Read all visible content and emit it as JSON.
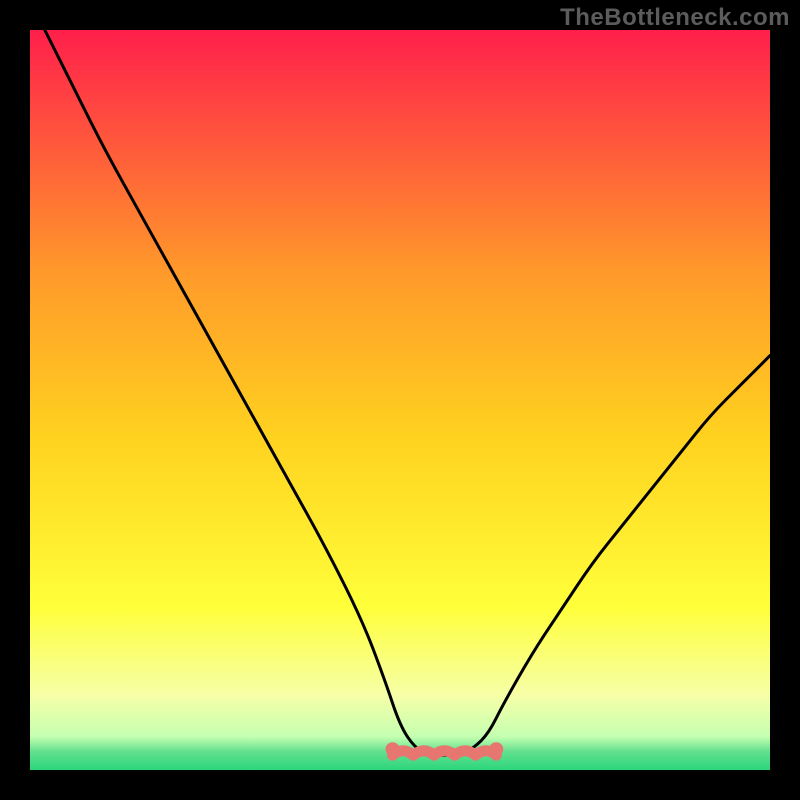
{
  "watermark": "TheBottleneck.com",
  "colors": {
    "frame_bg": "#000000",
    "watermark": "#5c5c5c",
    "curve": "#000000",
    "bottom_bar": "#e77670",
    "grad_top": "#ff1f4b",
    "grad_mid1": "#ff7a2a",
    "grad_mid2": "#ffd21f",
    "grad_mid3": "#ffff3a",
    "grad_low1": "#f6ffa8",
    "grad_low2": "#c4ffb0",
    "grad_bottom": "#2bd67b"
  },
  "chart_data": {
    "type": "line",
    "title": "",
    "xlabel": "",
    "ylabel": "",
    "xlim": [
      0,
      100
    ],
    "ylim": [
      0,
      100
    ],
    "series": [
      {
        "name": "bottleneck-curve",
        "x": [
          2,
          6,
          10,
          15,
          20,
          25,
          30,
          35,
          40,
          45,
          48,
          50,
          52,
          54,
          56,
          58,
          60,
          62,
          64,
          68,
          72,
          76,
          80,
          84,
          88,
          92,
          96,
          100
        ],
        "y": [
          100,
          92,
          84,
          75,
          66,
          57,
          48,
          39,
          30,
          20,
          12,
          6,
          3,
          2,
          2,
          2,
          3,
          5,
          9,
          16,
          22,
          28,
          33,
          38,
          43,
          48,
          52,
          56
        ]
      }
    ],
    "flat_segment": {
      "name": "optimal-zone-marker",
      "x_start": 49,
      "x_end": 63,
      "y": 2,
      "color": "#e77670"
    },
    "gradient_stops": [
      {
        "offset": 0.0,
        "color": "#ff1f4b"
      },
      {
        "offset": 0.33,
        "color": "#ff9a2a"
      },
      {
        "offset": 0.55,
        "color": "#ffd21f"
      },
      {
        "offset": 0.78,
        "color": "#ffff3a"
      },
      {
        "offset": 0.9,
        "color": "#f6ffa8"
      },
      {
        "offset": 0.955,
        "color": "#c4ffb0"
      },
      {
        "offset": 0.975,
        "color": "#63e08e"
      },
      {
        "offset": 1.0,
        "color": "#2bd67b"
      }
    ]
  }
}
